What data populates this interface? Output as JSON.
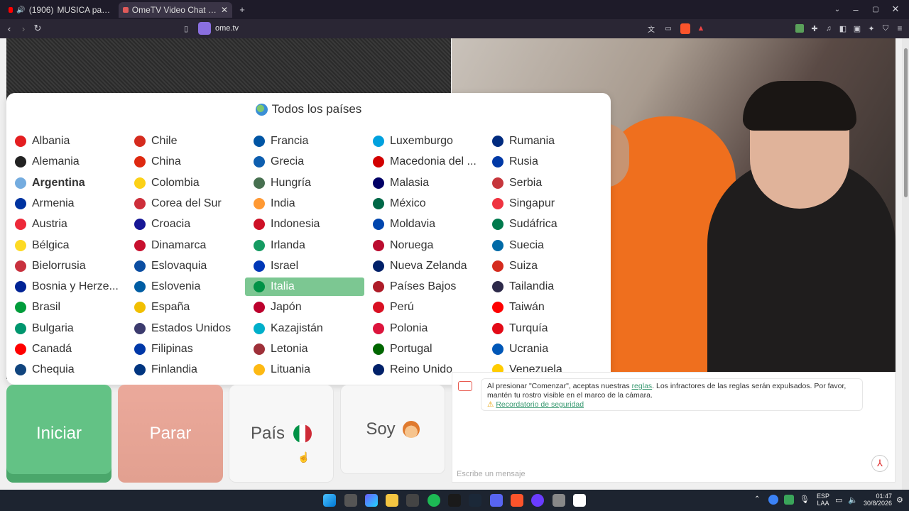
{
  "browser": {
    "tabs": [
      {
        "count": "(1906)",
        "title": "MUSICA para TWITCH"
      },
      {
        "title": "OmeTV Video Chat — Omeg"
      }
    ],
    "url": "ome.tv"
  },
  "country_panel": {
    "title": "Todos los países",
    "countries": [
      {
        "name": "Albania",
        "flag": "#e41e20"
      },
      {
        "name": "Alemania",
        "flag": "#222222"
      },
      {
        "name": "Argentina",
        "flag": "#74acdf",
        "bold": true
      },
      {
        "name": "Armenia",
        "flag": "#0033a0"
      },
      {
        "name": "Austria",
        "flag": "#ed2939"
      },
      {
        "name": "Bélgica",
        "flag": "#fdda24"
      },
      {
        "name": "Bielorrusia",
        "flag": "#c8313e"
      },
      {
        "name": "Bosnia y Herze...",
        "flag": "#002395"
      },
      {
        "name": "Brasil",
        "flag": "#009c3b"
      },
      {
        "name": "Bulgaria",
        "flag": "#00966e"
      },
      {
        "name": "Canadá",
        "flag": "#ff0000"
      },
      {
        "name": "Chequia",
        "flag": "#11457e"
      },
      {
        "name": "Chile",
        "flag": "#d52b1e"
      },
      {
        "name": "China",
        "flag": "#de2910"
      },
      {
        "name": "Colombia",
        "flag": "#fcd116"
      },
      {
        "name": "Corea del Sur",
        "flag": "#cd2e3a"
      },
      {
        "name": "Croacia",
        "flag": "#171796"
      },
      {
        "name": "Dinamarca",
        "flag": "#c8102e"
      },
      {
        "name": "Eslovaquia",
        "flag": "#0b4ea2"
      },
      {
        "name": "Eslovenia",
        "flag": "#005da4"
      },
      {
        "name": "España",
        "flag": "#f1bf00"
      },
      {
        "name": "Estados Unidos",
        "flag": "#3c3b6e"
      },
      {
        "name": "Filipinas",
        "flag": "#0038a8"
      },
      {
        "name": "Finlandia",
        "flag": "#003580"
      },
      {
        "name": "Francia",
        "flag": "#0055a4"
      },
      {
        "name": "Grecia",
        "flag": "#0d5eaf"
      },
      {
        "name": "Hungría",
        "flag": "#477050"
      },
      {
        "name": "India",
        "flag": "#ff9933"
      },
      {
        "name": "Indonesia",
        "flag": "#ce1126"
      },
      {
        "name": "Irlanda",
        "flag": "#169b62"
      },
      {
        "name": "Israel",
        "flag": "#0038b8"
      },
      {
        "name": "Italia",
        "flag": "#009246",
        "selected": true
      },
      {
        "name": "Japón",
        "flag": "#bc002d"
      },
      {
        "name": "Kazajistán",
        "flag": "#00afca"
      },
      {
        "name": "Letonia",
        "flag": "#9e3039"
      },
      {
        "name": "Lituania",
        "flag": "#fdb913"
      },
      {
        "name": "Luxemburgo",
        "flag": "#00a1de"
      },
      {
        "name": "Macedonia del ...",
        "flag": "#d20000"
      },
      {
        "name": "Malasia",
        "flag": "#010066"
      },
      {
        "name": "México",
        "flag": "#006847"
      },
      {
        "name": "Moldavia",
        "flag": "#0046ae"
      },
      {
        "name": "Noruega",
        "flag": "#ba0c2f"
      },
      {
        "name": "Nueva Zelanda",
        "flag": "#012169"
      },
      {
        "name": "Países Bajos",
        "flag": "#ae1c28"
      },
      {
        "name": "Perú",
        "flag": "#d91023"
      },
      {
        "name": "Polonia",
        "flag": "#dc143c"
      },
      {
        "name": "Portugal",
        "flag": "#006600"
      },
      {
        "name": "Reino Unido",
        "flag": "#012169"
      },
      {
        "name": "Rumania",
        "flag": "#002b7f"
      },
      {
        "name": "Rusia",
        "flag": "#0039a6"
      },
      {
        "name": "Serbia",
        "flag": "#c6363c"
      },
      {
        "name": "Singapur",
        "flag": "#ef3340"
      },
      {
        "name": "Sudáfrica",
        "flag": "#007a4d"
      },
      {
        "name": "Suecia",
        "flag": "#006aa7"
      },
      {
        "name": "Suiza",
        "flag": "#d52b1e"
      },
      {
        "name": "Tailandia",
        "flag": "#2d2a4a"
      },
      {
        "name": "Taiwán",
        "flag": "#fe0000"
      },
      {
        "name": "Turquía",
        "flag": "#e30a17"
      },
      {
        "name": "Ucrania",
        "flag": "#0057b7"
      },
      {
        "name": "Venezuela",
        "flag": "#ffcc00"
      }
    ]
  },
  "controls": {
    "start_label": "Iniciar",
    "stop_label": "Parar",
    "country_label": "País",
    "soy_label": "Soy"
  },
  "chat": {
    "message_prefix": "Al presionar \"Comenzar\", aceptas nuestras ",
    "rules_link": "reglas",
    "message_suffix": ". Los infractores de las reglas serán expulsados. Por favor, mantén tu rostro visible en el marco de la cámara.",
    "safety_link": "Recordatorio de seguridad",
    "input_placeholder": "Escribe un mensaje"
  },
  "taskbar": {
    "lang1": "ESP",
    "lang2": "LAA",
    "time": "01:47",
    "date": "30/8/2026"
  }
}
